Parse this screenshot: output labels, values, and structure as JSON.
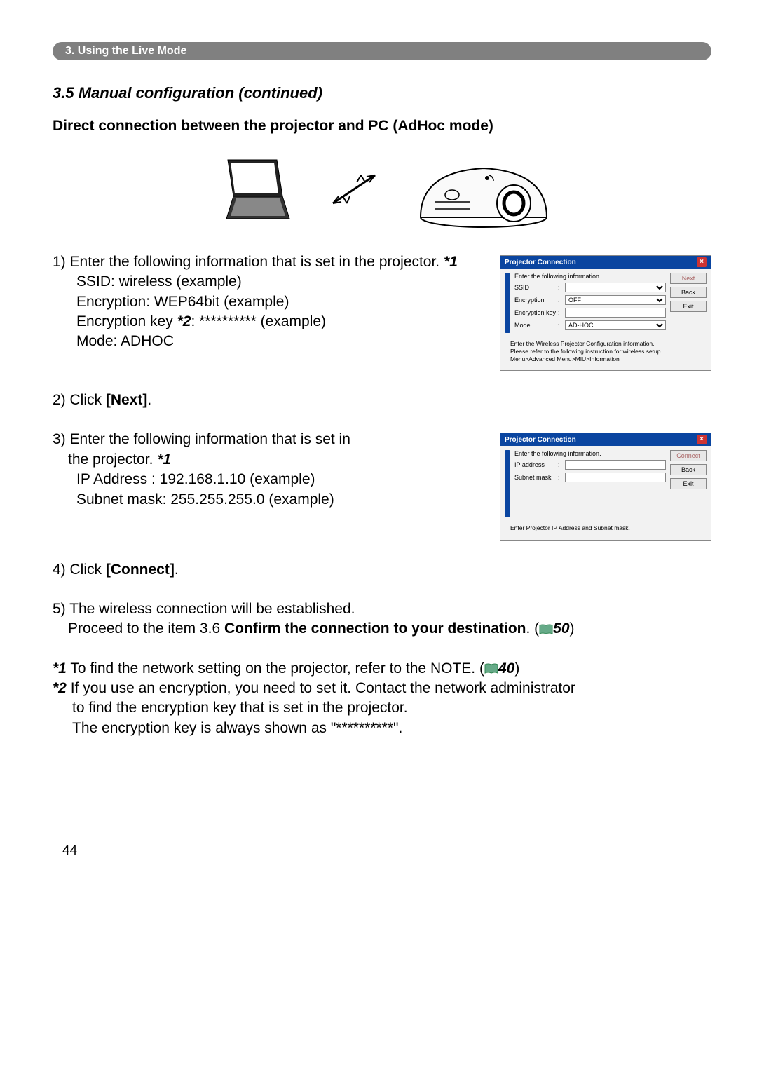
{
  "breadcrumb": "3. Using the Live Mode",
  "section_title": "3.5 Manual configuration (continued)",
  "subheading": "Direct connection between the projector and PC (AdHoc mode)",
  "step1": {
    "line": "1) Enter the following information that is set in the projector. ",
    "ref": "*1",
    "ssid": "SSID: wireless (example)",
    "enc": "Encryption: WEP64bit (example)",
    "key_prefix": "Encryption key ",
    "key_ref": "*2",
    "key_suffix": ": ********** (example)",
    "mode": "Mode: ADHOC"
  },
  "dialog1": {
    "title": "Projector Connection",
    "header": "Enter the following information.",
    "ssid_label": "SSID",
    "enc_label": "Encryption",
    "enc_value": "OFF",
    "key_label": "Encryption key",
    "mode_label": "Mode",
    "mode_value": "AD-HOC",
    "btn_next": "Next",
    "btn_back": "Back",
    "btn_exit": "Exit",
    "footer_l1": "Enter the Wireless Projector Configuration information.",
    "footer_l2": "Please refer to the following instruction for wireless setup.",
    "footer_l3": "Menu>Advanced Menu>MIU>Information"
  },
  "step2": {
    "prefix": "2) Click ",
    "btn": "[Next]",
    "suffix": "."
  },
  "step3": {
    "line1": "3) Enter the following information that is set in",
    "line2_prefix": "the projector. ",
    "ref": "*1",
    "ip": "IP Address : 192.168.1.10 (example)",
    "subnet": "Subnet mask: 255.255.255.0 (example)"
  },
  "dialog2": {
    "title": "Projector Connection",
    "header": "Enter the following information.",
    "ip_label": "IP address",
    "subnet_label": "Subnet mask",
    "btn_connect": "Connect",
    "btn_back": "Back",
    "btn_exit": "Exit",
    "footer": "Enter Projector IP Address and Subnet mask."
  },
  "step4": {
    "prefix": "4) Click ",
    "btn": "[Connect]",
    "suffix": "."
  },
  "step5": {
    "l1": "5) The wireless connection will be established.",
    "l2a": "Proceed to the item 3.6 ",
    "l2b": "Confirm the connection to your destination",
    "l2c": ". (",
    "l2_ref": "50",
    "l2d": ")"
  },
  "fn1": {
    "ref": "*1",
    "text_a": " To find the network setting on the projector, refer to the NOTE. (",
    "text_ref": "40",
    "text_b": ")"
  },
  "fn2": {
    "ref": "*2",
    "l1": " If you use an encryption, you need to set it.  Contact the network administrator",
    "l2": "to find the encryption key that is set in the projector.",
    "l3": "The encryption key is always shown as \"**********\"."
  },
  "page_number": "44"
}
